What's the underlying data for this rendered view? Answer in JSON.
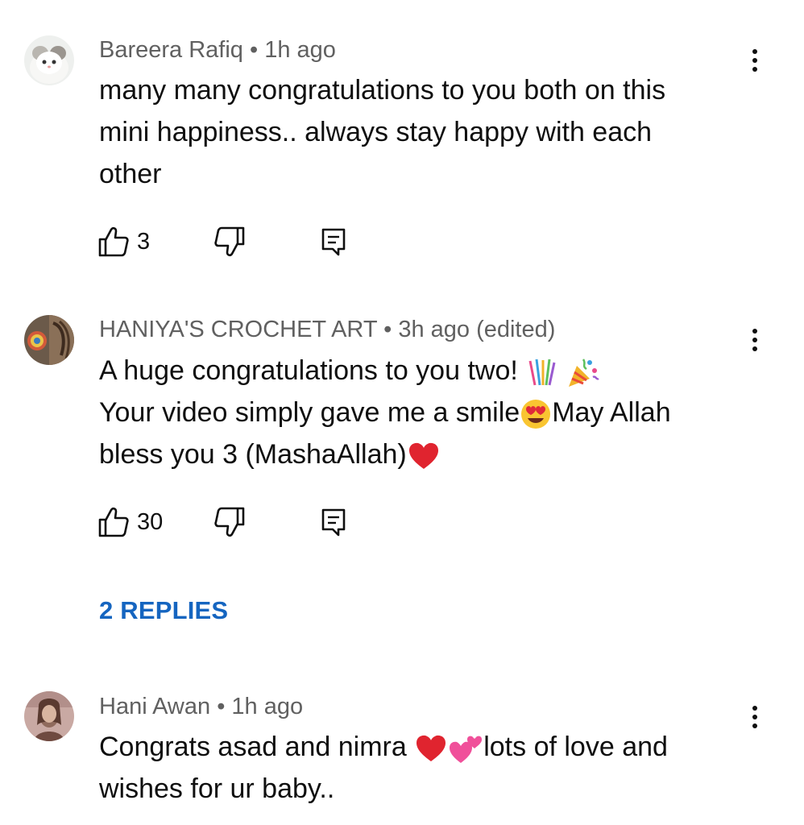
{
  "comments": [
    {
      "author": "Bareera Rafiq",
      "separator": "•",
      "time": "1h ago",
      "body_lines": [
        "many many congratulations to you both on this",
        "mini happiness.. always stay happy with each",
        "other"
      ],
      "likes": "3",
      "avatar_icon": "kitten-avatar-icon"
    },
    {
      "author": "HANIYA'S CROCHET ART",
      "separator": "•",
      "time": "3h ago (edited)",
      "body_lines": [
        [
          "A huge congratulations to you two!"
        ],
        [
          "Your video simply gave me a smile",
          "May Allah"
        ],
        [
          "bless you 3 (MashaAllah)"
        ]
      ],
      "likes": "30",
      "replies_label": "2 REPLIES",
      "avatar_icon": "crochet-avatar-icon",
      "emojis": [
        "confetti-ball-icon",
        "party-popper-icon",
        "heart-eyes-icon",
        "red-heart-icon"
      ]
    },
    {
      "author": "Hani Awan",
      "separator": "•",
      "time": "1h ago",
      "body_lines": [
        [
          "Congrats asad and nimra ",
          "lots of love and"
        ],
        [
          "wishes for ur baby.."
        ]
      ],
      "avatar_icon": "person-avatar-icon",
      "emojis": [
        "red-heart-icon",
        "two-hearts-icon"
      ]
    }
  ],
  "colors": {
    "meta": "#606060",
    "text": "#0f0f0f",
    "link": "#1565c0"
  }
}
